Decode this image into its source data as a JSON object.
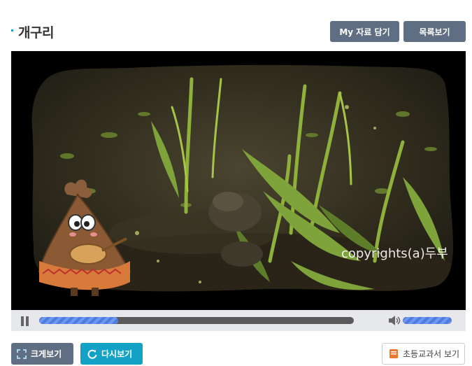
{
  "page": {
    "title": "개구리"
  },
  "header": {
    "my_data_label": "My 자료 담기",
    "list_label": "목록보기"
  },
  "video": {
    "watermark": "copyrights(a)두부",
    "progress_fraction": 0.25,
    "volume_fraction": 1.0
  },
  "footer": {
    "fullscreen_label": "크게보기",
    "replay_label": "다시보기",
    "textbook_label": "초등교과서 보기"
  },
  "colors": {
    "accent": "#1aa3c9",
    "button_gray": "#5f6e82",
    "button_cyan": "#13a2c6",
    "progress_blue": "#5b88e8"
  },
  "icons": [
    "pause-icon",
    "volume-icon",
    "fullscreen-icon",
    "replay-icon",
    "book-icon"
  ]
}
